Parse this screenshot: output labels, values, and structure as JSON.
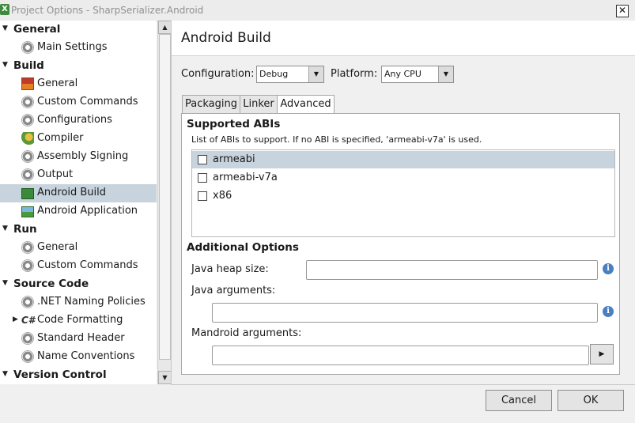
{
  "window": {
    "title": "Project Options - SharpSerializer.Android",
    "close_glyph": "✕"
  },
  "sidebar": {
    "rows": [
      {
        "kind": "section",
        "label": "General"
      },
      {
        "kind": "item",
        "label": "Main Settings",
        "icon": "gear-icon"
      },
      {
        "kind": "section",
        "label": "Build"
      },
      {
        "kind": "item",
        "label": "General",
        "icon": "build-bricks-icon"
      },
      {
        "kind": "item",
        "label": "Custom Commands",
        "icon": "gear-icon"
      },
      {
        "kind": "item",
        "label": "Configurations",
        "icon": "gear-icon"
      },
      {
        "kind": "item",
        "label": "Compiler",
        "icon": "compiler-icon"
      },
      {
        "kind": "item",
        "label": "Assembly Signing",
        "icon": "gear-icon"
      },
      {
        "kind": "item",
        "label": "Output",
        "icon": "gear-icon"
      },
      {
        "kind": "item",
        "label": "Android Build",
        "icon": "android-build-icon",
        "selected": true
      },
      {
        "kind": "item",
        "label": "Android Application",
        "icon": "android-app-icon"
      },
      {
        "kind": "section",
        "label": "Run"
      },
      {
        "kind": "item",
        "label": "General",
        "icon": "run-gear-icon"
      },
      {
        "kind": "item",
        "label": "Custom Commands",
        "icon": "gear-icon"
      },
      {
        "kind": "section",
        "label": "Source Code"
      },
      {
        "kind": "item",
        "label": ".NET Naming Policies",
        "icon": "gear-icon"
      },
      {
        "kind": "item",
        "label": "Code Formatting",
        "icon": "code-formatting-icon",
        "collapsed": true
      },
      {
        "kind": "item",
        "label": "Standard Header",
        "icon": "gear-icon"
      },
      {
        "kind": "item",
        "label": "Name Conventions",
        "icon": "gear-icon"
      },
      {
        "kind": "section",
        "label": "Version Control"
      }
    ]
  },
  "main": {
    "title": "Android Build",
    "configuration_label": "Configuration:",
    "configuration_value": "Debug",
    "platform_label": "Platform:",
    "platform_value": "Any CPU",
    "tabs": [
      {
        "label": "Packaging"
      },
      {
        "label": "Linker"
      },
      {
        "label": "Advanced",
        "active": true
      }
    ],
    "supported_abis": {
      "heading": "Supported ABIs",
      "description": "List of ABIs to support. If no ABI is specified, 'armeabi-v7a' is used.",
      "items": [
        {
          "label": "armeabi",
          "checked": false,
          "selected": true
        },
        {
          "label": "armeabi-v7a",
          "checked": false
        },
        {
          "label": "x86",
          "checked": false
        }
      ]
    },
    "additional_options": {
      "heading": "Additional Options",
      "java_heap_label": "Java heap size:",
      "java_heap_value": "",
      "java_args_label": "Java arguments:",
      "java_args_value": "",
      "mandroid_args_label": "Mandroid arguments:",
      "mandroid_args_value": "",
      "info_glyph": "i",
      "run_glyph": "▶"
    }
  },
  "footer": {
    "cancel_label": "Cancel",
    "ok_label": "OK"
  },
  "colors": {
    "selection": "#c7d3dd",
    "info": "#4a7fc0"
  }
}
